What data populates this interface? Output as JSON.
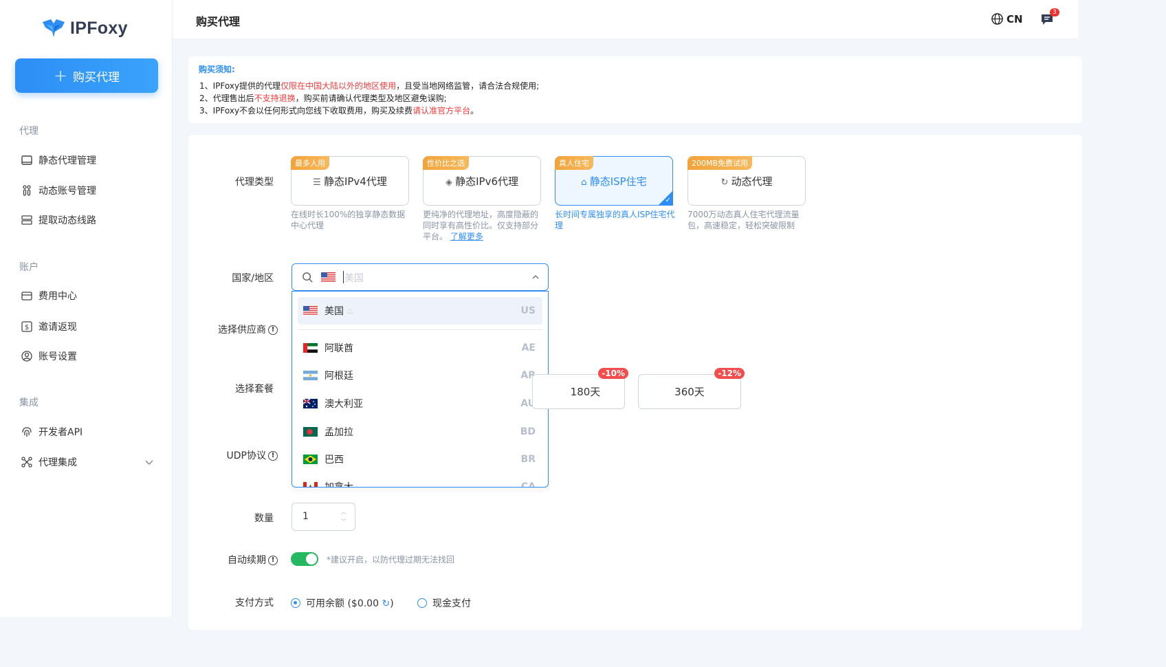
{
  "brand": {
    "logo_text": "IPFoxy"
  },
  "sidebar": {
    "buy_button": "购买代理",
    "sections": [
      {
        "title": "代理",
        "items": [
          "静态代理管理",
          "动态账号管理",
          "提取动态线路"
        ]
      },
      {
        "title": "账户",
        "items": [
          "费用中心",
          "邀请返现",
          "账号设置"
        ]
      },
      {
        "title": "集成",
        "items": [
          "开发者API",
          "代理集成"
        ]
      }
    ]
  },
  "header": {
    "title": "购买代理",
    "language": "CN",
    "message_count": "3"
  },
  "notice": {
    "title": "购买须知:",
    "line1_a": "1、IPFoxy提供的代理",
    "line1_red": "仅限在中国大陆以外的地区使用",
    "line1_b": "，且受当地网络监管，请合法合规使用;",
    "line2_a": "2、代理售出后",
    "line2_red": "不支持退换",
    "line2_b": "，购买前请确认代理类型及地区避免误购;",
    "line3_a": "3、IPFoxy不会以任何形式向您线下收取费用，购买及续费",
    "line3_red": "请认准官方平台",
    "line3_b": "。"
  },
  "form": {
    "proxy_type_label": "代理类型",
    "proxy_types": [
      {
        "tag": "最多人用",
        "name": "静态IPv4代理",
        "desc": "在线时长100%的独享静态数据中心代理",
        "selected": false
      },
      {
        "tag": "性价比之选",
        "name": "静态IPv6代理",
        "desc": "更纯净的代理地址，高度隐蔽的同时享有高性价比。仅支持部分平台。",
        "desc_link": "了解更多",
        "selected": false
      },
      {
        "tag": "真人住宅",
        "name": "静态ISP住宅",
        "desc": "长时间专属独享的真人ISP住宅代理",
        "selected": true
      },
      {
        "tag": "200MB免费试用",
        "name": "动态代理",
        "desc": "7000万动态真人住宅代理流量包，高速稳定，轻松突破限制",
        "selected": false
      }
    ],
    "country_label": "国家/地区",
    "country_placeholder": "美国",
    "countries": [
      {
        "name": "美国",
        "code": "US",
        "selected": true
      },
      {
        "name": "阿联酋",
        "code": "AE"
      },
      {
        "name": "阿根廷",
        "code": "AR"
      },
      {
        "name": "澳大利亚",
        "code": "AU"
      },
      {
        "name": "孟加拉",
        "code": "BD"
      },
      {
        "name": "巴西",
        "code": "BR"
      },
      {
        "name": "加拿大",
        "code": "CA"
      }
    ],
    "provider_label": "选择供应商",
    "plan_label": "选择套餐",
    "plans": [
      {
        "name": "180天",
        "discount": "-10%"
      },
      {
        "name": "360天",
        "discount": "-12%"
      }
    ],
    "udp_label": "UDP协议",
    "quantity_label": "数量",
    "quantity_value": "1",
    "auto_renew_label": "自动续期",
    "auto_renew_on": true,
    "auto_renew_hint": "*建议开启，以防代理过期无法找回",
    "payment_label": "支付方式",
    "payment_balance": "可用余额 ($0.00",
    "payment_balance_close": ")",
    "payment_cash": "现金支付"
  },
  "colors": {
    "accent": "#2d8ef5",
    "danger": "#f24c4c",
    "tag": "#f3a33a",
    "toggle": "#24b860"
  }
}
